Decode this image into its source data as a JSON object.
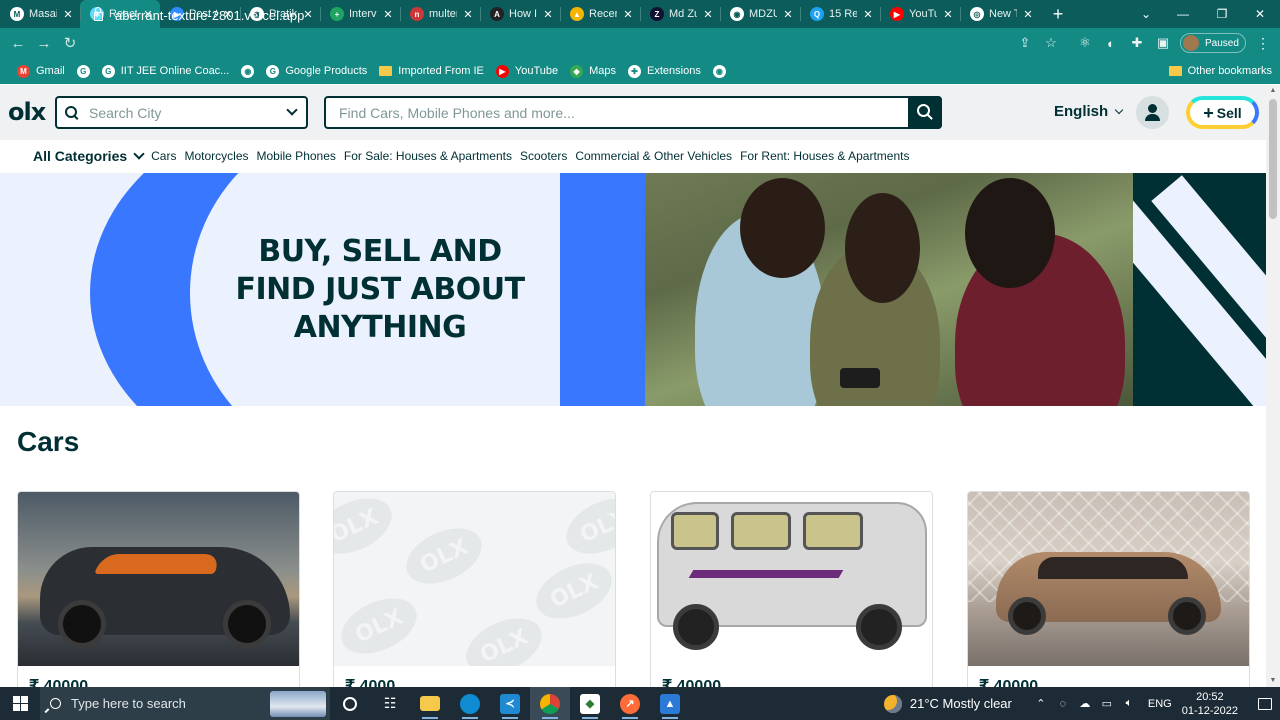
{
  "browser": {
    "tabs": [
      {
        "title": "Masai",
        "color": "#ffffff",
        "glyph": "M"
      },
      {
        "title": "React",
        "color": "#61dafb",
        "glyph": "⚛"
      },
      {
        "title": "Post A",
        "color": "#2d8cff",
        "glyph": "▶"
      },
      {
        "title": "Pratik",
        "color": "#ffffff",
        "glyph": "◉"
      },
      {
        "title": "Interv",
        "color": "#1fa463",
        "glyph": "+"
      },
      {
        "title": "multer",
        "color": "#cb3837",
        "glyph": "n"
      },
      {
        "title": "How I",
        "color": "#222222",
        "glyph": "A"
      },
      {
        "title": "Recen",
        "color": "#f4b400",
        "glyph": "▲"
      },
      {
        "title": "Md Zu",
        "color": "#111133",
        "glyph": "Z"
      },
      {
        "title": "MDZU",
        "color": "#ffffff",
        "glyph": "◉"
      },
      {
        "title": "15 Re",
        "color": "#1da1f2",
        "glyph": "Q"
      },
      {
        "title": "YouTu",
        "color": "#ff0000",
        "glyph": "▶"
      },
      {
        "title": "New T",
        "color": "#ffffff",
        "glyph": "◎"
      }
    ],
    "active_tab_index": 1,
    "url": "aberrant-texture-2801.vercel.app",
    "profile_label": "Paused",
    "bookmarks": [
      {
        "label": "Gmail",
        "color": "#ea4335",
        "glyph": "M"
      },
      {
        "label": "",
        "color": "#ffffff",
        "glyph": "G"
      },
      {
        "label": "IIT JEE Online Coac...",
        "color": "#ffffff",
        "glyph": "G"
      },
      {
        "label": "",
        "color": "#ffffff",
        "glyph": "◉"
      },
      {
        "label": "Google Products",
        "color": "#ffffff",
        "glyph": "G"
      },
      {
        "label": "Imported From IE",
        "color": "#f6c94a",
        "glyph": ""
      },
      {
        "label": "YouTube",
        "color": "#ff0000",
        "glyph": "▶"
      },
      {
        "label": "Maps",
        "color": "#34a853",
        "glyph": "◆"
      },
      {
        "label": "Extensions",
        "color": "#ffffff",
        "glyph": "✚"
      },
      {
        "label": "",
        "color": "#ffffff",
        "glyph": "◉"
      }
    ],
    "other_bookmarks": "Other bookmarks"
  },
  "header": {
    "logo": "olx",
    "city_placeholder": "Search City",
    "search_placeholder": "Find Cars, Mobile Phones and more...",
    "language": "English",
    "sell_label": "Sell"
  },
  "categories": {
    "all_label": "All Categories",
    "items": [
      "Cars",
      "Motorcycles",
      "Mobile Phones",
      "For Sale: Houses & Apartments",
      "Scooters",
      "Commercial & Other Vehicles",
      "For Rent: Houses & Apartments"
    ]
  },
  "banner": {
    "headline_line1": "BUY, SELL AND",
    "headline_line2": "FIND JUST ABOUT",
    "headline_line3": "ANYTHING"
  },
  "section": {
    "title": "Cars",
    "cards": [
      {
        "price": "₹ 40000"
      },
      {
        "price": "₹ 4000"
      },
      {
        "price": "₹ 40000"
      },
      {
        "price": "₹ 40000"
      }
    ]
  },
  "taskbar": {
    "search_placeholder": "Type here to search",
    "weather": "21°C  Mostly clear",
    "lang": "ENG",
    "time": "20:52",
    "date": "01-12-2022"
  },
  "colors": {
    "olx_dark": "#002f34",
    "olx_blue": "#3a77ff",
    "chrome_teal": "#138a84"
  }
}
